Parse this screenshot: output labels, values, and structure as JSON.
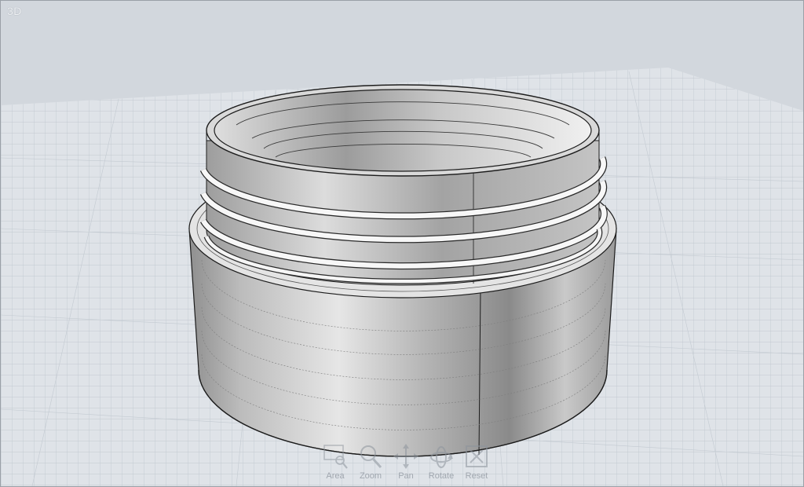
{
  "viewport": {
    "label": "3D"
  },
  "toolbar": {
    "tools": [
      {
        "label": "Area",
        "icon": "area-zoom-icon"
      },
      {
        "label": "Zoom",
        "icon": "zoom-icon"
      },
      {
        "label": "Pan",
        "icon": "pan-icon"
      },
      {
        "label": "Rotate",
        "icon": "rotate-icon"
      },
      {
        "label": "Reset",
        "icon": "reset-view-icon"
      }
    ]
  },
  "colors": {
    "background": "#d2d7dd",
    "grid_floor": "#dde2e7",
    "grid_line": "#b8c0c8",
    "model_shade": "#a9a9a9",
    "model_highlight": "#f2f2f2",
    "thread": "#f6f6f6"
  }
}
